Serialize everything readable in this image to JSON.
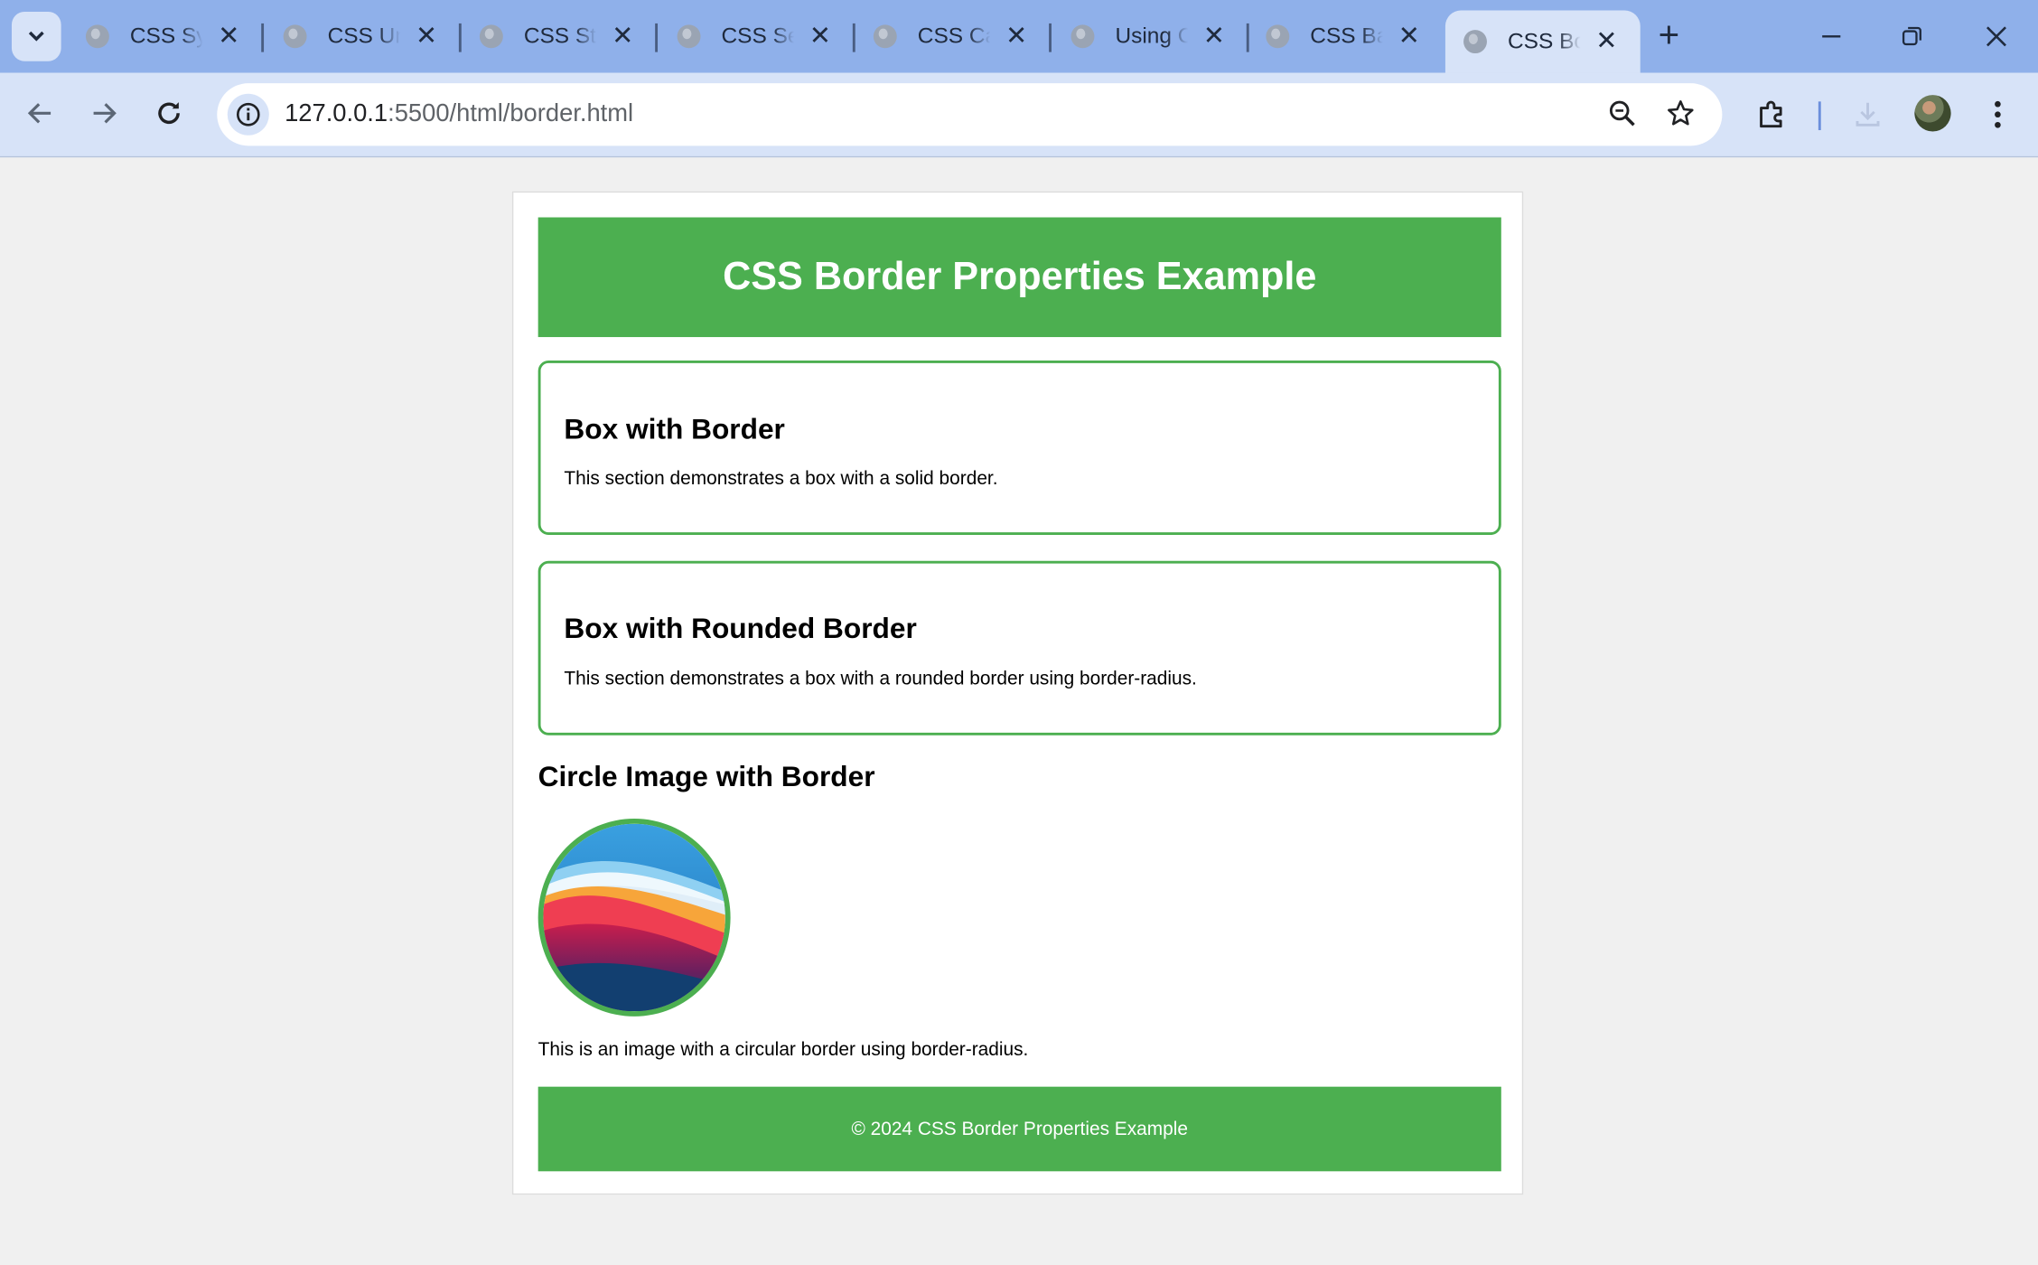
{
  "browser": {
    "tabs": [
      {
        "title": "CSS Syntax",
        "active": false
      },
      {
        "title": "CSS Units",
        "active": false
      },
      {
        "title": "CSS Styling",
        "active": false
      },
      {
        "title": "CSS Selectors",
        "active": false
      },
      {
        "title": "CSS Cascade",
        "active": false
      },
      {
        "title": "Using CSS",
        "active": false
      },
      {
        "title": "CSS Background",
        "active": false
      },
      {
        "title": "CSS Border",
        "active": true
      }
    ],
    "url_host": "127.0.0.1",
    "url_path": ":5500/html/border.html"
  },
  "page": {
    "header_title": "CSS Border Properties Example",
    "sections": [
      {
        "heading": "Box with Border",
        "text": "This section demonstrates a box with a solid border."
      },
      {
        "heading": "Box with Rounded Border",
        "text": "This section demonstrates a box with a rounded border using border-radius."
      }
    ],
    "image_section": {
      "heading": "Circle Image with Border",
      "caption": "This is an image with a circular border using border-radius."
    },
    "footer_text": "© 2024 CSS Border Properties Example"
  },
  "colors": {
    "accent_green": "#4caf50",
    "tabstrip": "#8fb0ea",
    "toolbar": "#d7e3f8",
    "page_bg": "#f0f0f0"
  },
  "icons": [
    "chevron-down-icon",
    "globe-icon",
    "close-icon",
    "plus-icon",
    "minimize-icon",
    "restore-icon",
    "window-close-icon",
    "back-arrow-icon",
    "forward-arrow-icon",
    "reload-icon",
    "info-icon",
    "zoom-icon",
    "star-icon",
    "extensions-icon",
    "download-icon",
    "more-vert-icon"
  ]
}
